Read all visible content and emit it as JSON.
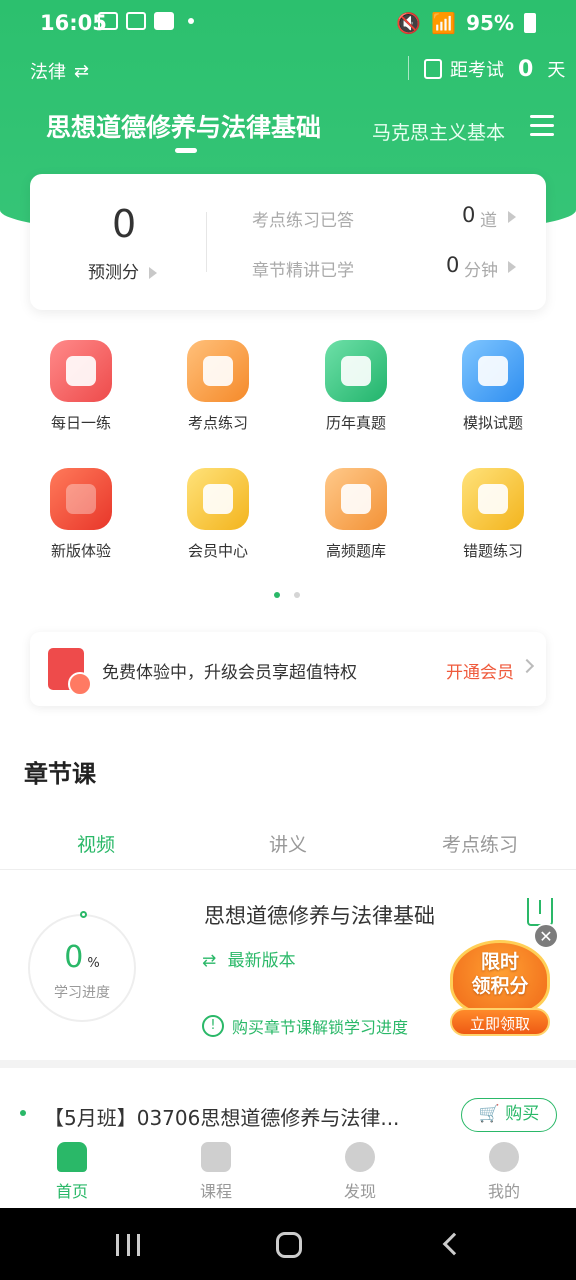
{
  "status_bar": {
    "time": "16:05",
    "battery": "95%"
  },
  "header": {
    "subject": "法律",
    "exam_prefix": "距考试",
    "exam_days": "0",
    "exam_suffix": "天",
    "active_tab": "思想道德修养与法律基础",
    "secondary_tab": "马克思主义基本"
  },
  "stats": {
    "predict_value": "0",
    "predict_label": "预测分",
    "practice_label": "考点练习已答",
    "practice_value": "0",
    "practice_unit": "道",
    "lecture_label": "章节精讲已学",
    "lecture_value": "0",
    "lecture_unit": "分钟"
  },
  "features": [
    {
      "label": "每日一练",
      "icon": "calendar-check-icon",
      "color": "#f25c5c"
    },
    {
      "label": "考点练习",
      "icon": "lightning-doc-icon",
      "color": "#f79a3a"
    },
    {
      "label": "历年真题",
      "icon": "doc-icon",
      "color": "#2fc07d"
    },
    {
      "label": "模拟试题",
      "icon": "chart-board-icon",
      "color": "#3b9cf0"
    },
    {
      "label": "新版体验",
      "icon": "rocket-icon",
      "color": "#f04a3a"
    },
    {
      "label": "会员中心",
      "icon": "crown-icon",
      "color": "#f6c02b"
    },
    {
      "label": "高频题库",
      "icon": "wave-doc-icon",
      "color": "#f6a244"
    },
    {
      "label": "错题练习",
      "icon": "wrong-x-icon",
      "color": "#f6c02b"
    }
  ],
  "promo": {
    "text": "免费体验中，升级会员享超值特权",
    "cta": "开通会员"
  },
  "section": {
    "title": "章节课"
  },
  "sub_tabs": [
    "视频",
    "讲义",
    "考点练习"
  ],
  "course": {
    "progress_value": "0",
    "progress_unit": "%",
    "progress_label": "学习进度",
    "title": "思想道德修养与法律基础",
    "version": "最新版本",
    "unlock_text": "购买章节课解锁学习进度"
  },
  "float_badge": {
    "line1": "限时",
    "line2": "领积分",
    "button": "立即领取"
  },
  "class_item": {
    "title": "【5月班】03706思想道德修养与法律...",
    "buy": "购买"
  },
  "bottom_nav": [
    "首页",
    "课程",
    "发现",
    "我的"
  ]
}
